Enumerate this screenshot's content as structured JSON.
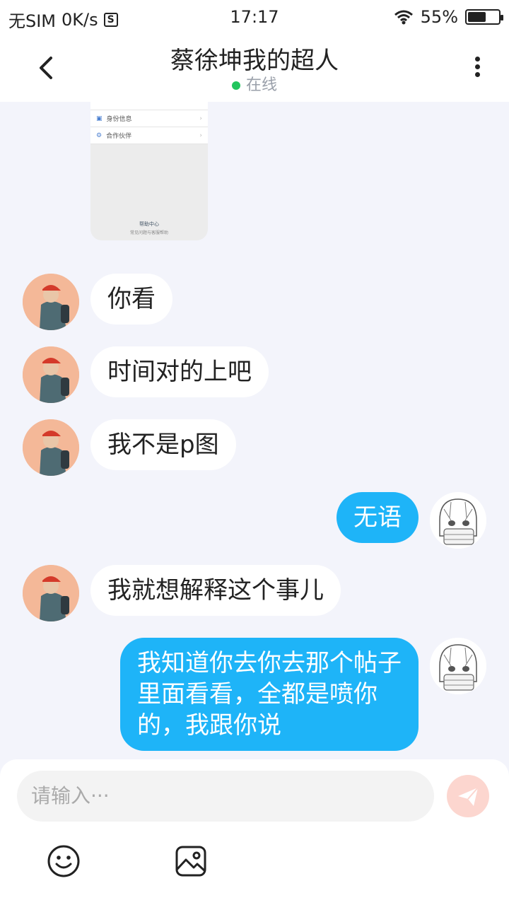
{
  "status_bar": {
    "carrier": "无SIM",
    "speed": "0K/s",
    "sim_icon_text": "S",
    "time": "17:17",
    "battery": "55%"
  },
  "header": {
    "title": "蔡徐坤我的超人",
    "status": "在线"
  },
  "screenshot_preview": {
    "rows": [
      "身份信息",
      "合作伙伴"
    ],
    "help_title": "帮助中心",
    "help_sub": "常见问题与客服帮助"
  },
  "messages": [
    {
      "from": "other",
      "text": "你看"
    },
    {
      "from": "other",
      "text": "时间对的上吧"
    },
    {
      "from": "other",
      "text": "我不是p图"
    },
    {
      "from": "me",
      "text": "无语"
    },
    {
      "from": "other",
      "text": "我就想解释这个事儿"
    },
    {
      "from": "me",
      "line1": "我知道你去你去那个帖子",
      "line2": "里面看看，全都是喷你",
      "line3": "的，我跟你说"
    }
  ],
  "composer": {
    "placeholder": "请输入···"
  },
  "colors": {
    "my_bubble": "#1eb4f8",
    "background": "#f3f4fb",
    "online_dot": "#22c55e"
  },
  "icons": [
    "back-arrow-icon",
    "more-vertical-icon",
    "send-icon",
    "emoji-icon",
    "image-icon"
  ]
}
